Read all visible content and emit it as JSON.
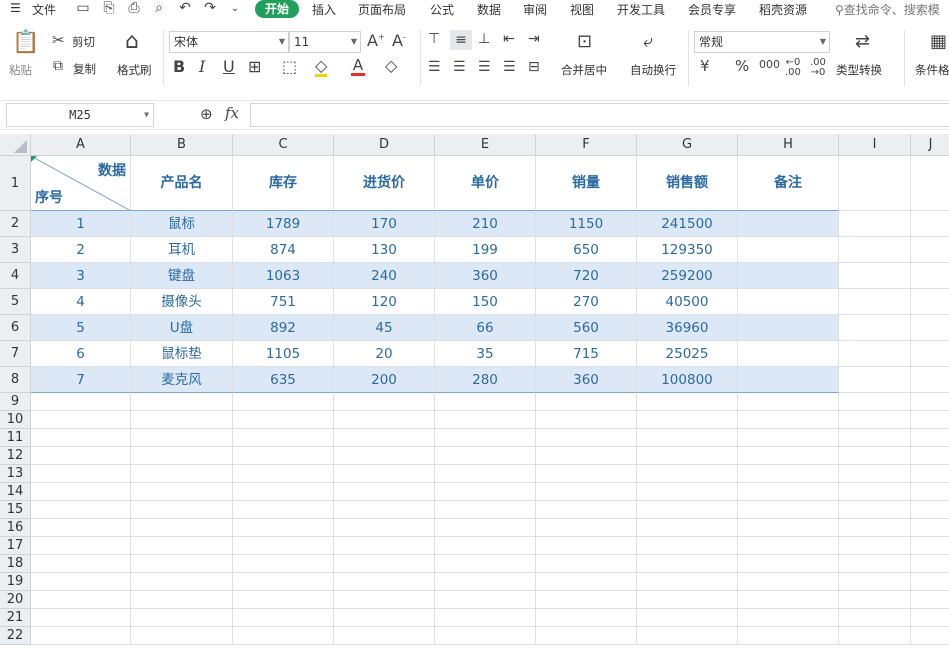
{
  "menubar": {
    "file_label": "文件",
    "tabs": [
      "开始",
      "插入",
      "页面布局",
      "公式",
      "数据",
      "审阅",
      "视图",
      "开发工具",
      "会员专享",
      "稻壳资源"
    ],
    "active_tab": "开始",
    "search_placeholder": "查找命令、搜索模"
  },
  "ribbon": {
    "paste": "粘贴",
    "cut": "剪切",
    "copy": "复制",
    "format_painter": "格式刷",
    "font_name": "宋体",
    "font_size": "11",
    "merge_center": "合并居中",
    "wrap_text": "自动换行",
    "number_format": "常规",
    "type_convert": "类型转换",
    "conditional_format": "条件格",
    "currency_symbol": "¥",
    "percent_symbol": "%",
    "thousands_symbol": "000"
  },
  "formula_bar": {
    "cell_ref": "M25",
    "fx": "fx",
    "value": ""
  },
  "sheet": {
    "columns": [
      "A",
      "B",
      "C",
      "D",
      "E",
      "F",
      "G",
      "H",
      "I",
      "J"
    ],
    "row_numbers": [
      "1",
      "2",
      "3",
      "4",
      "5",
      "6",
      "7",
      "8",
      "9",
      "10",
      "11",
      "12",
      "13",
      "14",
      "15",
      "16",
      "17",
      "18",
      "19",
      "20",
      "21",
      "22"
    ],
    "diag_top": "数据",
    "diag_bottom": "序号",
    "headers": [
      "产品名",
      "库存",
      "进货价",
      "单价",
      "销量",
      "销售额",
      "备注"
    ],
    "rows": [
      [
        "1",
        "鼠标",
        "1789",
        "170",
        "210",
        "1150",
        "241500",
        ""
      ],
      [
        "2",
        "耳机",
        "874",
        "130",
        "199",
        "650",
        "129350",
        ""
      ],
      [
        "3",
        "键盘",
        "1063",
        "240",
        "360",
        "720",
        "259200",
        ""
      ],
      [
        "4",
        "摄像头",
        "751",
        "120",
        "150",
        "270",
        "40500",
        ""
      ],
      [
        "5",
        "U盘",
        "892",
        "45",
        "66",
        "560",
        "36960",
        ""
      ],
      [
        "6",
        "鼠标垫",
        "1105",
        "20",
        "35",
        "715",
        "25025",
        ""
      ],
      [
        "7",
        "麦克风",
        "635",
        "200",
        "280",
        "360",
        "100800",
        ""
      ]
    ]
  },
  "colors": {
    "accent": "#1fa05a",
    "cell_text": "#2b6aa3",
    "band": "#dce8f6"
  }
}
